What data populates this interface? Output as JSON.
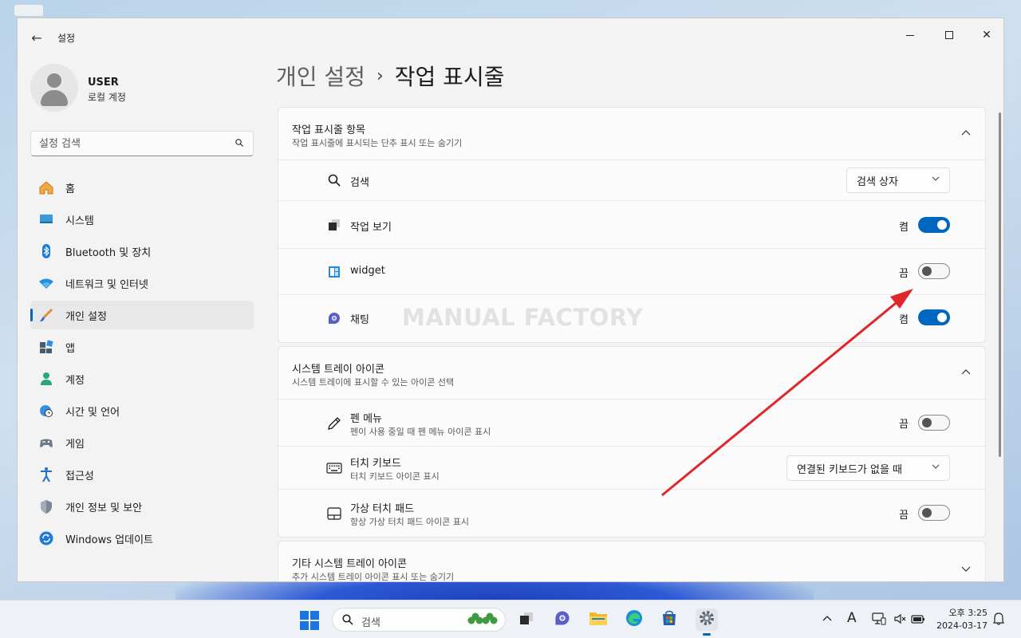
{
  "window": {
    "app_title": "설정",
    "back_label": "←",
    "minimize_label": "",
    "maximize_label": "",
    "close_label": "✕"
  },
  "user": {
    "name": "USER",
    "account_type": "로컬 계정"
  },
  "search": {
    "placeholder": "설정 검색",
    "value": ""
  },
  "sidebar": {
    "items": [
      {
        "label": "홈",
        "icon": "home-icon"
      },
      {
        "label": "시스템",
        "icon": "system-icon"
      },
      {
        "label": "Bluetooth 및 장치",
        "icon": "bluetooth-icon"
      },
      {
        "label": "네트워크 및 인터넷",
        "icon": "wifi-icon"
      },
      {
        "label": "개인 설정",
        "icon": "brush-icon",
        "selected": true
      },
      {
        "label": "앱",
        "icon": "apps-icon"
      },
      {
        "label": "계정",
        "icon": "account-icon"
      },
      {
        "label": "시간 및 언어",
        "icon": "globe-clock-icon"
      },
      {
        "label": "게임",
        "icon": "gamepad-icon"
      },
      {
        "label": "접근성",
        "icon": "accessibility-icon"
      },
      {
        "label": "개인 정보 및 보안",
        "icon": "shield-icon"
      },
      {
        "label": "Windows 업데이트",
        "icon": "update-icon"
      }
    ]
  },
  "breadcrumb": {
    "parent": "개인 설정",
    "separator": "›",
    "current": "작업 표시줄"
  },
  "sections": {
    "taskbar_items": {
      "title": "작업 표시줄 항목",
      "subtitle": "작업 표시줄에 표시되는 단추 표시 또는 숨기기",
      "rows": [
        {
          "label": "검색",
          "icon": "search-icon",
          "control": "dropdown",
          "value": "검색 상자"
        },
        {
          "label": "작업 보기",
          "icon": "task-view-icon",
          "control": "toggle",
          "state": "켬",
          "on": true
        },
        {
          "label": "widget",
          "icon": "widgets-icon",
          "control": "toggle",
          "state": "끔",
          "on": false
        },
        {
          "label": "채팅",
          "icon": "chat-icon",
          "control": "toggle",
          "state": "켬",
          "on": true
        }
      ]
    },
    "tray_icons": {
      "title": "시스템 트레이 아이콘",
      "subtitle": "시스템 트레이에 표시할 수 있는 아이콘 선택",
      "rows": [
        {
          "label": "펜 메뉴",
          "sub": "펜이 사용 중일 때 펜 메뉴 아이콘 표시",
          "icon": "pen-icon",
          "control": "toggle",
          "state": "끔",
          "on": false
        },
        {
          "label": "터치 키보드",
          "sub": "터치 키보드 아이콘 표시",
          "icon": "keyboard-icon",
          "control": "dropdown",
          "value": "연결된 키보드가 없을 때"
        },
        {
          "label": "가상 터치 패드",
          "sub": "항상 가상 터치 패드 아이콘 표시",
          "icon": "touchpad-icon",
          "control": "toggle",
          "state": "끔",
          "on": false
        }
      ]
    },
    "other_tray": {
      "title": "기타 시스템 트레이 아이콘",
      "subtitle": "추가 시스템 트레이 아이콘 표시 또는 숨기기"
    }
  },
  "watermark": "MANUAL FACTORY",
  "taskbar": {
    "search_label": "검색",
    "clock_time": "오후 3:25",
    "clock_date": "2024-03-17",
    "ime_label": "A",
    "accent": "#0067c0"
  }
}
